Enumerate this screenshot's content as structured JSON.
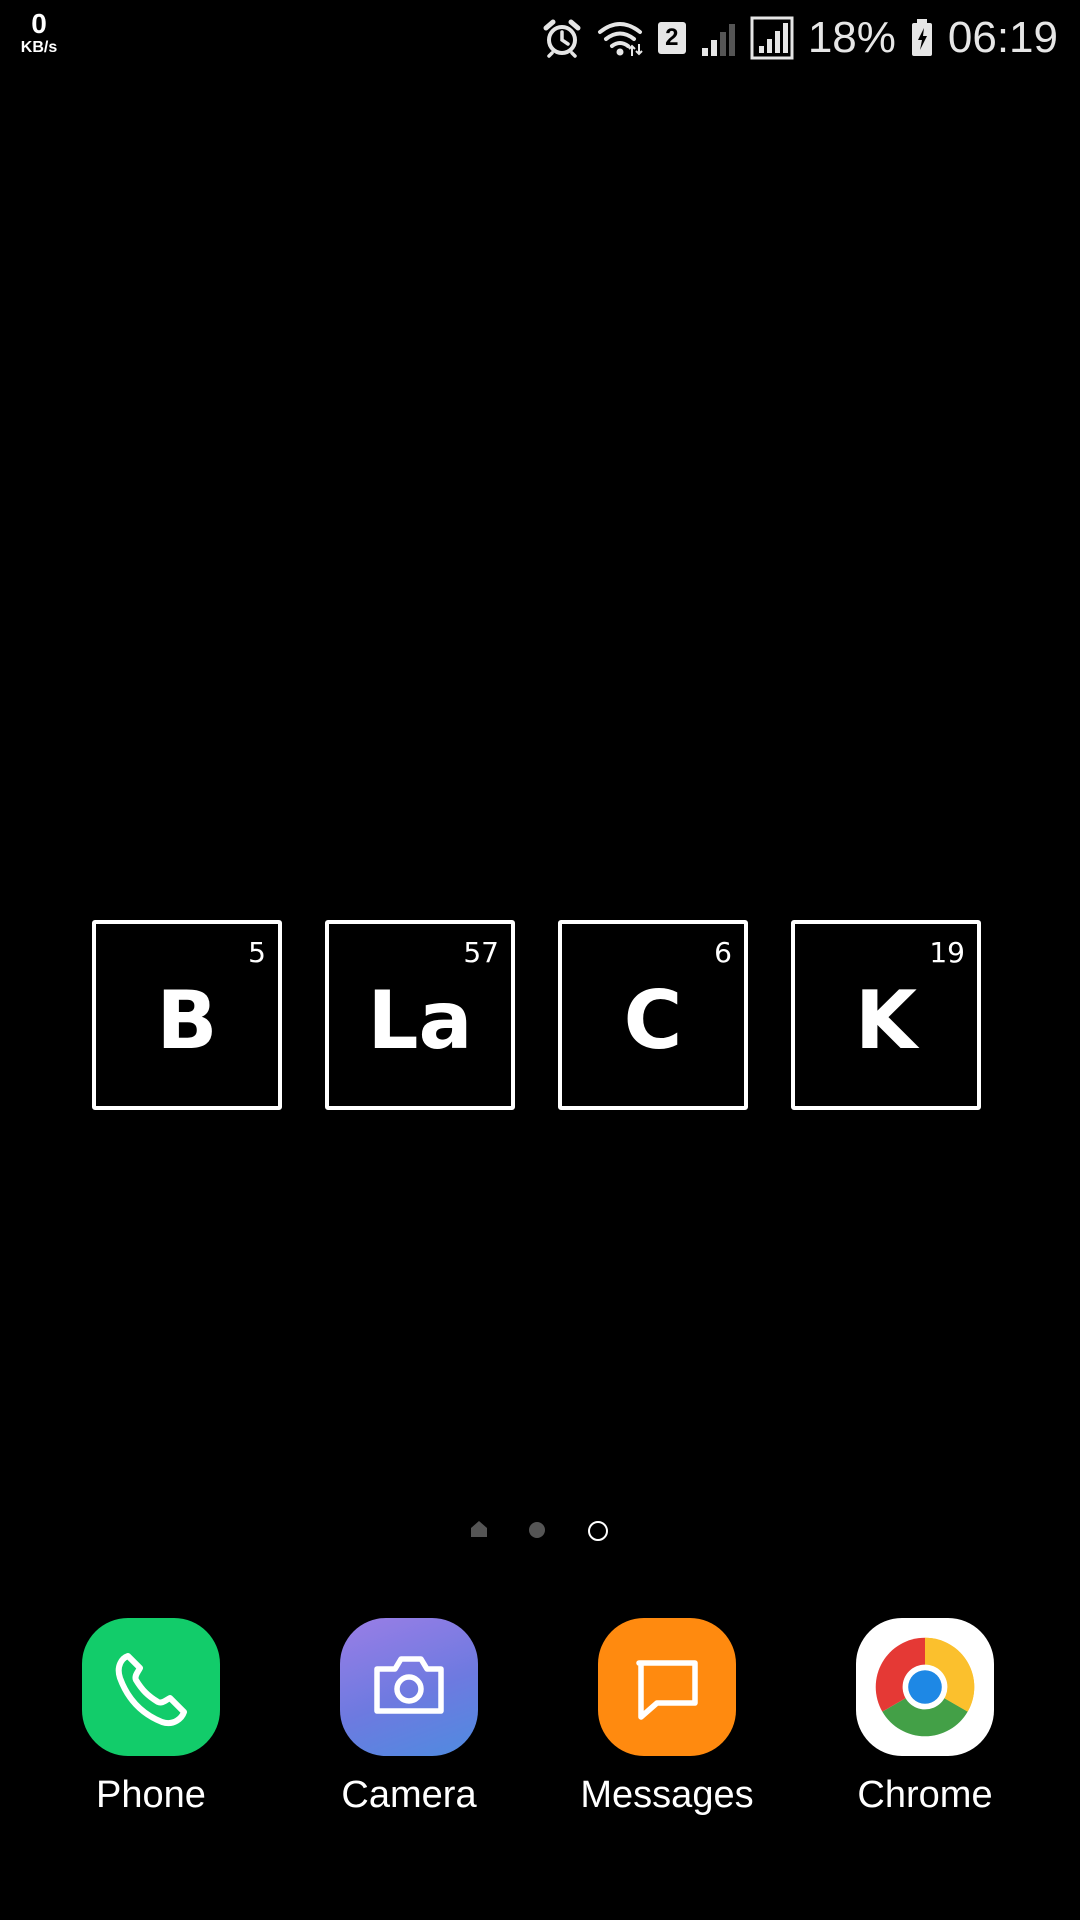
{
  "status_bar": {
    "net_speed_value": "0",
    "net_speed_unit": "KB/s",
    "sim_slot": "2",
    "battery_percent": "18%",
    "time": "06:19",
    "icons": [
      "alarm-icon",
      "wifi-icon",
      "sim-2-badge",
      "signal-weak-icon",
      "signal-full-icon",
      "battery-charging-icon"
    ]
  },
  "wallpaper": {
    "tiles": [
      {
        "symbol": "B",
        "number": "5"
      },
      {
        "symbol": "La",
        "number": "57"
      },
      {
        "symbol": "C",
        "number": "6"
      },
      {
        "symbol": "K",
        "number": "19"
      }
    ]
  },
  "page_indicator": {
    "pages": 3,
    "current": 3,
    "icons": [
      "home-page-icon",
      "page-dot",
      "current-page-dot"
    ]
  },
  "dock": {
    "apps": [
      {
        "label": "Phone",
        "icon": "phone-icon",
        "color": "#12cc6a"
      },
      {
        "label": "Camera",
        "icon": "camera-icon",
        "color": "#6d7ae0"
      },
      {
        "label": "Messages",
        "icon": "messages-icon",
        "color": "#ff8a0f"
      },
      {
        "label": "Chrome",
        "icon": "chrome-icon",
        "color": "#ffffff"
      }
    ]
  }
}
